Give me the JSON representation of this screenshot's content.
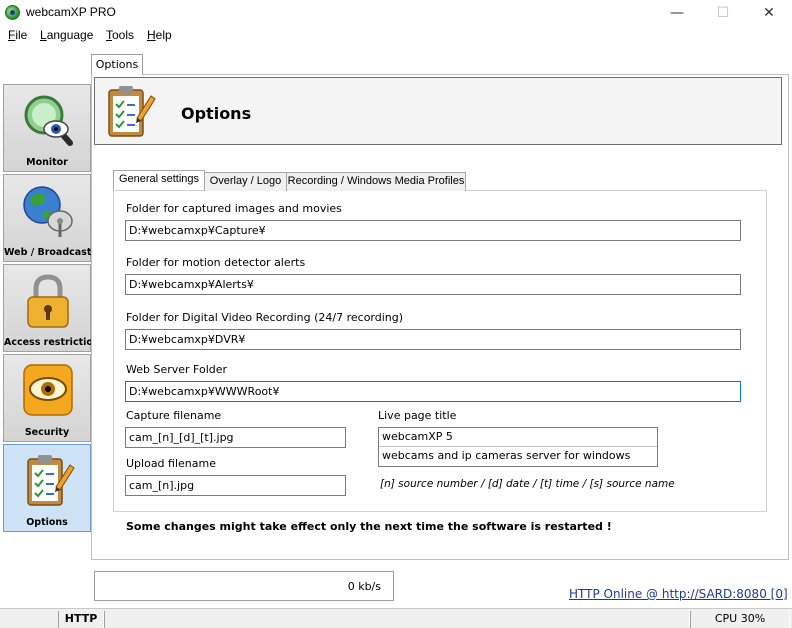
{
  "window": {
    "title": "webcamXP PRO",
    "controls": {
      "minimize": "—",
      "maximize": "☐",
      "close": "✕"
    }
  },
  "menu": [
    {
      "label": "File",
      "underline": "F",
      "rest": "ile"
    },
    {
      "label": "Language",
      "underline": "L",
      "rest": "anguage"
    },
    {
      "label": "Tools",
      "underline": "T",
      "rest": "ools"
    },
    {
      "label": "Help",
      "underline": "H",
      "rest": "elp"
    }
  ],
  "nav": [
    {
      "label": "Monitor",
      "icon": "monitor-magnifier-icon"
    },
    {
      "label": "Web / Broadcast",
      "icon": "globe-satellite-icon"
    },
    {
      "label": "Access restriction",
      "icon": "padlock-icon"
    },
    {
      "label": "Security",
      "icon": "eye-shield-icon"
    },
    {
      "label": "Options",
      "icon": "clipboard-pencil-icon",
      "active": true
    }
  ],
  "top_tab": "Options",
  "header": {
    "title": "Options"
  },
  "tabs": [
    {
      "label": "General settings",
      "selected": true
    },
    {
      "label": "Overlay / Logo"
    },
    {
      "label": "Recording / Windows Media Profiles"
    }
  ],
  "general": {
    "captured_label": "Folder for captured images and movies",
    "captured_value": "D:¥webcamxp¥Capture¥",
    "alerts_label": "Folder for motion detector alerts",
    "alerts_value": "D:¥webcamxp¥Alerts¥",
    "dvr_label": "Folder for Digital Video Recording (24/7 recording)",
    "dvr_value": "D:¥webcamxp¥DVR¥",
    "webserver_label": "Web Server Folder",
    "webserver_value": "D:¥webcamxp¥WWWRoot¥",
    "capture_filename_label": "Capture filename",
    "capture_filename_value": "cam_[n]_[d]_[t].jpg",
    "upload_filename_label": "Upload filename",
    "upload_filename_value": "cam_[n].jpg",
    "live_title_label": "Live page title",
    "live_title_line1": "webcamXP 5",
    "live_title_line2": "webcams and ip cameras server for windows",
    "hint": "[n] source number / [d] date / [t] time / [s] source name"
  },
  "warning": "Some changes might take effect only the next time the software is restarted !",
  "bandwidth": "0 kb/s",
  "http_status": "HTTP Online @ http://SARD:8080 [0]",
  "statusbar": {
    "http": "HTTP",
    "cpu": "CPU 30%"
  },
  "colors": {
    "accent": "#0078d7",
    "link": "#1a3a9a",
    "active_nav": "#cfe3f7"
  }
}
